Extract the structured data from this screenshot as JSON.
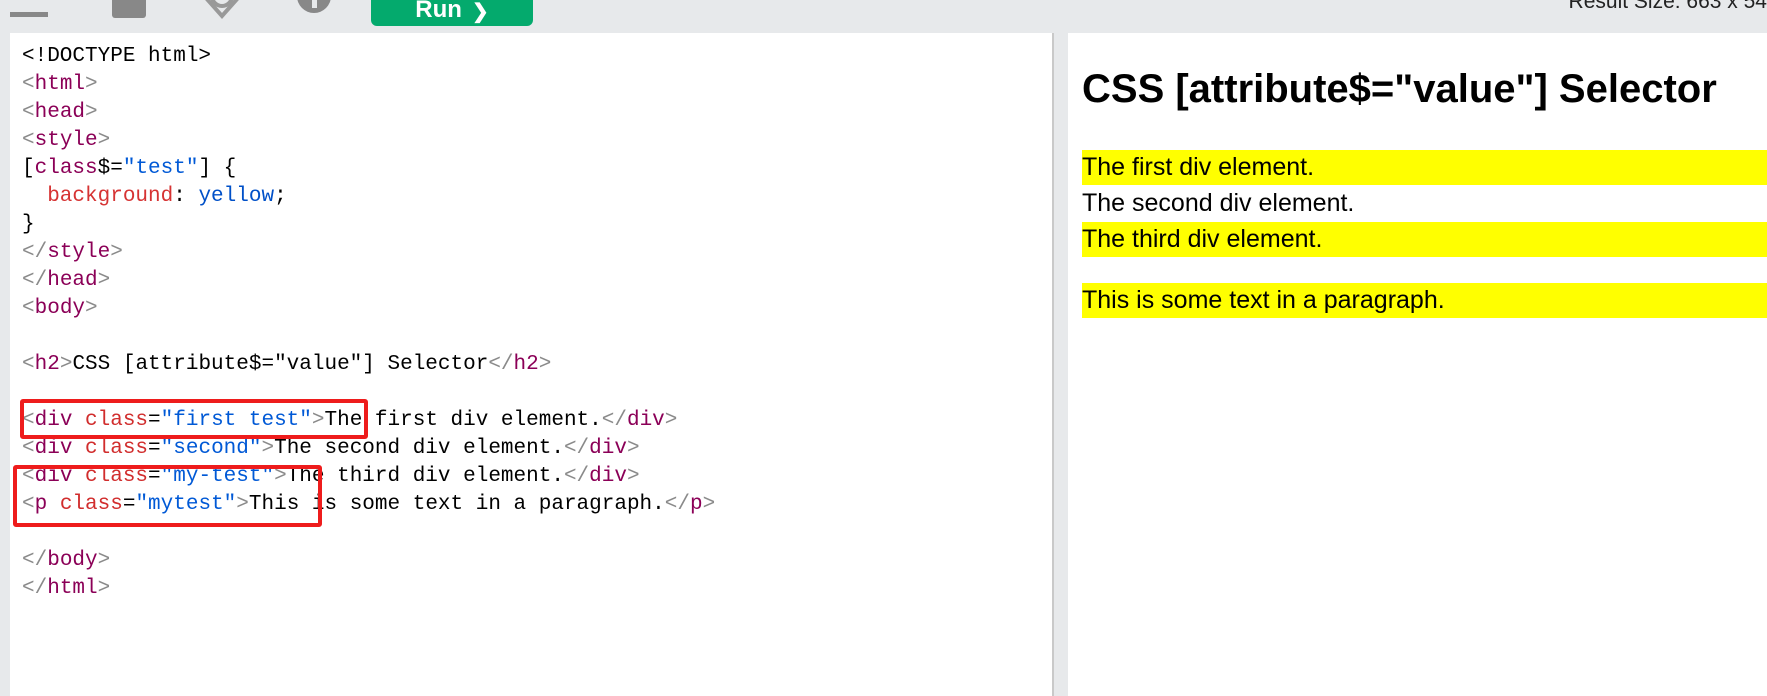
{
  "toolbar": {
    "icons": [
      "menu-icon",
      "save-icon",
      "theme-icon",
      "orientation-icon"
    ],
    "run_label": "Run",
    "run_arrow": "❯",
    "result_size": "Result Size: 663 x 54"
  },
  "code": {
    "l1": "<!DOCTYPE html>",
    "l2_open": "<",
    "l2_name": "html",
    "l2_close": ">",
    "l3_open": "<",
    "l3_name": "head",
    "l3_close": ">",
    "l4_open": "<",
    "l4_name": "style",
    "l4_close": ">",
    "l5_a": "[",
    "l5_attr": "class",
    "l5_b": "$=",
    "l5_val": "\"test\"",
    "l5_c": "] {",
    "l6_prop": "  background",
    "l6_colon": ": ",
    "l6_val": "yellow",
    "l6_semi": ";",
    "l7": "}",
    "l8_open": "</",
    "l8_name": "style",
    "l8_close": ">",
    "l9_open": "</",
    "l9_name": "head",
    "l9_close": ">",
    "l10_open": "<",
    "l10_name": "body",
    "l10_close": ">",
    "l12_open": "<",
    "l12_name": "h2",
    "l12_close": ">",
    "l12_text": "CSS [attribute$=\"value\"] Selector",
    "l12_end_open": "</",
    "l12_end_name": "h2",
    "l12_end_close": ">",
    "l14_open": "<",
    "l14_name": "div",
    "l14_attr": " class",
    "l14_eq": "=",
    "l14_val": "\"first test\"",
    "l14_close": ">",
    "l14_text": "The first div element.",
    "l14_end_open": "</",
    "l14_end_name": "div",
    "l14_end_close": ">",
    "l15_open": "<",
    "l15_name": "div",
    "l15_attr": " class",
    "l15_eq": "=",
    "l15_val": "\"second\"",
    "l15_close": ">",
    "l15_text": "The second div element.",
    "l15_end_open": "</",
    "l15_end_name": "div",
    "l15_end_close": ">",
    "l16_open": "<",
    "l16_name": "div",
    "l16_attr": " class",
    "l16_eq": "=",
    "l16_val": "\"my-test\"",
    "l16_close": ">",
    "l16_text": "The third div element.",
    "l16_end_open": "</",
    "l16_end_name": "div",
    "l16_end_close": ">",
    "l17_open": "<",
    "l17_name": "p",
    "l17_attr": " class",
    "l17_eq": "=",
    "l17_val": "\"mytest\"",
    "l17_close": ">",
    "l17_text": "This is some text in a paragraph.",
    "l17_end_open": "</",
    "l17_end_name": "p",
    "l17_end_close": ">",
    "l19_open": "</",
    "l19_name": "body",
    "l19_close": ">",
    "l20_open": "</",
    "l20_name": "html",
    "l20_close": ">"
  },
  "result": {
    "heading": "CSS [attribute$=\"value\"] Selector",
    "div1": "The first div element.",
    "div2": "The second div element.",
    "div3": "The third div element.",
    "para": "This is some text in a paragraph.",
    "highlight_color": "#ffff00"
  },
  "colors": {
    "run_button": "#04aa6d",
    "annotation_box": "#ee1c1c",
    "tag_name": "#8b0057",
    "attribute": "#d12d2d",
    "attribute_value": "#0059d6"
  }
}
